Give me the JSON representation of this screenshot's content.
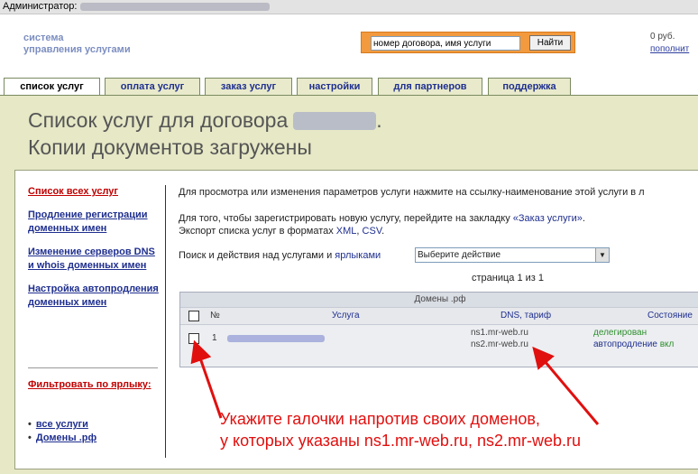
{
  "adminbar": {
    "label": "Администратор:"
  },
  "header": {
    "logo_line1": "система",
    "logo_line2": "управления услугами",
    "search_value": "номер договора, имя услуги",
    "search_button": "Найти",
    "balance_amount": "0 руб.",
    "balance_topup": "пополнит"
  },
  "tabs": [
    "список услуг",
    "оплата услуг",
    "заказ услуг",
    "настройки",
    "для партнеров",
    "поддержка"
  ],
  "page_title_line1": "Список услуг для договора",
  "page_title_dot": ".",
  "page_title_line2": "Копии документов загружены",
  "sidebar": {
    "items": [
      {
        "label": "Список всех услуг"
      },
      {
        "label": "Продление регистрации доменных имен"
      },
      {
        "label": "Изменение серверов DNS и whois доменных имен"
      },
      {
        "label": "Настройка автопродления доменных имен"
      }
    ],
    "filter_title": "Фильтровать по ярлыку:",
    "filters": [
      "все услуги",
      "Домены .рф"
    ]
  },
  "main": {
    "p1": "Для просмотра или изменения параметров услуги нажмите на ссылку-наименование этой услуги в л",
    "p2_prefix": "Для того, чтобы зарегистрировать новую услугу, перейдите на закладку ",
    "p2_link": "«Заказ услуги»",
    "p2_suffix": ".",
    "p3_prefix": "Экспорт списка услуг в форматах ",
    "p3_xml": "XML",
    "p3_sep": ", ",
    "p3_csv": "CSV",
    "p3_suffix": ".",
    "actions_prefix": "Поиск и действия над услугами и ",
    "actions_link": "ярлыками",
    "select_value": "Выберите действие",
    "pager": "страница 1 из 1"
  },
  "table": {
    "group_title": "Домены .рф",
    "col_num": "№",
    "col_service": "Услуга",
    "col_dns": "DNS, тариф",
    "col_status": "Состояние",
    "rows": [
      {
        "num": "1",
        "dns1": "ns1.mr-web.ru",
        "dns2": "ns2.mr-web.ru",
        "status1": "делегирован",
        "status2": "автопродление",
        "status2_value": "вкл"
      }
    ]
  },
  "note": {
    "line1": "Укажите галочки напротив своих доменов,",
    "line2": "у которых указаны ns1.mr-web.ru, ns2.mr-web.ru"
  },
  "colors": {
    "accent_red": "#e0100f",
    "link_blue": "#1f2f8f",
    "search_orange": "#f29a3d",
    "content_bg": "#e6e8c6"
  }
}
